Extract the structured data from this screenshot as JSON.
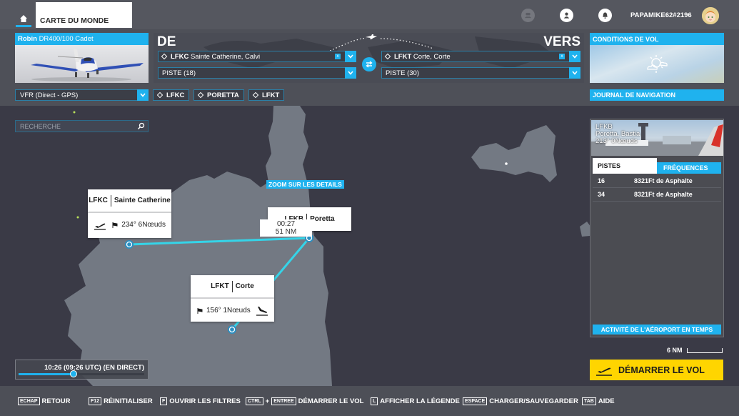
{
  "topbar": {
    "home_icon": "home-icon",
    "active_tab": "CARTE DU MONDE",
    "icons": [
      "friends-icon",
      "profile-icon",
      "notification-bell-icon"
    ],
    "username": "PAPAMIKE62#2196",
    "avatar": "avatar"
  },
  "aircraft": {
    "brand": "Robin",
    "model": "DR400/100 Cadet"
  },
  "route": {
    "from_label": "DE",
    "to_label": "VERS",
    "departure": {
      "code": "LFKC",
      "name": "Sainte Catherine, Calvi",
      "runway": "PISTE (18)"
    },
    "arrival": {
      "code": "LFKT",
      "name": "Corte, Corte",
      "runway": "PISTE (30)"
    },
    "clear_glyph": "x"
  },
  "conditions": {
    "title": "CONDITIONS DE VOL",
    "weather_icon": "partly-cloudy-icon"
  },
  "flight_plan": {
    "type": "VFR (Direct - GPS)",
    "waypoints": [
      "LFKC",
      "PORETTA",
      "LFKT"
    ]
  },
  "journal": {
    "label": "JOURNAL DE NAVIGATION"
  },
  "search": {
    "placeholder": "RECHERCHE"
  },
  "map": {
    "zoom_detail": "ZOOM SUR LES DETAILS",
    "route_color": "#35d4e8",
    "popups": {
      "lfkc": {
        "code": "LFKC",
        "name": "Sainte Catherine",
        "wind": "234° 6Nœuds"
      },
      "lfkb": {
        "code": "LFKB",
        "name": "Poretta"
      },
      "lfkt": {
        "code": "LFKT",
        "name": "Corte",
        "wind": "156° 1Nœuds"
      }
    },
    "leg": {
      "time": "00:27",
      "distance": "51 NM"
    }
  },
  "airport_info": {
    "code": "LFKB",
    "name": "Poretta, Bastia",
    "wind": "213° 0Nœuds",
    "tabs": [
      "PISTES",
      "FRÉQUENCES"
    ],
    "active_tab": "PISTES",
    "runways": [
      {
        "number": "16",
        "desc": "8321Ft de Asphalte"
      },
      {
        "number": "34",
        "desc": "8321Ft de Asphalte"
      }
    ],
    "activity_button": "ACTIVITÉ DE L'AÉROPORT EN TEMPS"
  },
  "scale": {
    "label": "6 NM"
  },
  "start_button": {
    "label": "DÉMARRER LE VOL"
  },
  "time": {
    "label": "10:26 (09:26 UTC) (EN DIRECT)",
    "progress_percent": 44
  },
  "hints": [
    {
      "keys": [
        "ECHAP"
      ],
      "label": "RETOUR"
    },
    {
      "keys": [
        "F12"
      ],
      "label": "RÉINITIALISER"
    },
    {
      "keys": [
        "F"
      ],
      "label": "OUVRIR LES FILTRES"
    },
    {
      "keys": [
        "CTRL",
        "ENTREE"
      ],
      "joiner": "+",
      "label": "DÉMARRER LE VOL"
    },
    {
      "keys": [
        "L"
      ],
      "label": "AFFICHER LA LÉGENDE"
    },
    {
      "keys": [
        "ESPACE"
      ],
      "label": "CHARGER/SAUVEGARDER"
    },
    {
      "keys": [
        "TAB"
      ],
      "label": "AIDE"
    }
  ],
  "colors": {
    "accent": "#1fb2ee",
    "start_button": "#ffd500",
    "sea": "#3a3a46",
    "land": "#737983"
  }
}
